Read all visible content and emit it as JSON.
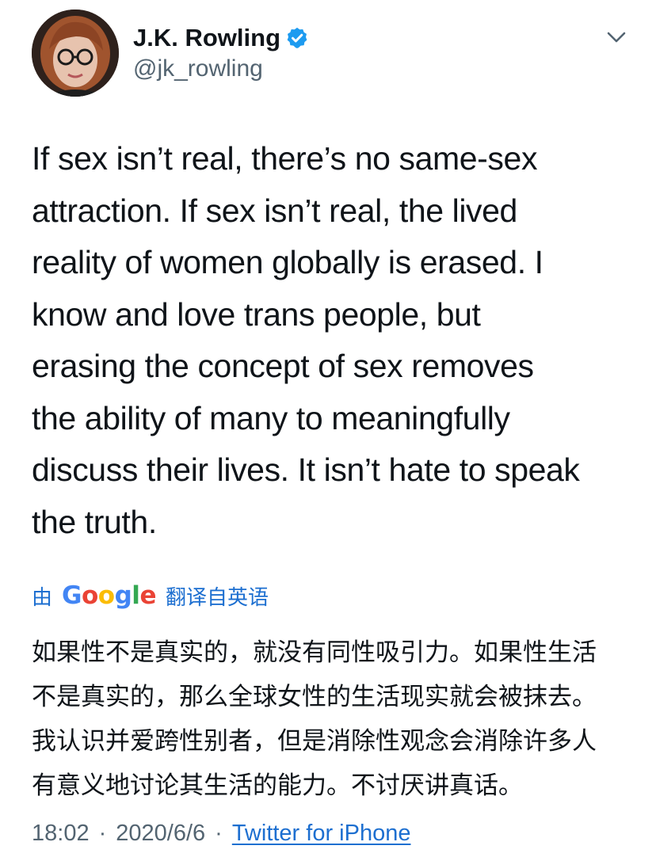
{
  "author": {
    "display_name": "J.K. Rowling",
    "handle": "@jk_rowling",
    "verified": true
  },
  "menu": {
    "icon": "chevron-down-icon"
  },
  "tweet": {
    "lines": [
      "If sex isn’t real, there’s no same-sex",
      "attraction. If sex isn’t real, the lived",
      "reality of women globally is erased. I",
      "know and love trans people, but",
      "erasing the concept of sex removes",
      "the ability of many to meaningfully",
      "discuss their lives. It isn’t hate to speak",
      "the truth."
    ]
  },
  "translation": {
    "by_label": "由",
    "provider_letters": [
      "G",
      "o",
      "o",
      "g",
      "l",
      "e"
    ],
    "from_label": "翻译自英语",
    "lines": [
      "如果性不是真实的，就没有同性吸引力。如果性生活",
      "不是真实的，那么全球女性的生活现实就会被抹去。",
      "我认识并爱跨性别者，但是消除性观念会消除许多人",
      "有意义地讨论其生活的能力。不讨厌讲真话。"
    ]
  },
  "meta": {
    "time": "18:02",
    "separator": "·",
    "date": "2020/6/6",
    "source": "Twitter for iPhone"
  },
  "colors": {
    "link": "#1d6fd0",
    "secondary": "#536471",
    "verified": "#1d9bf0"
  }
}
